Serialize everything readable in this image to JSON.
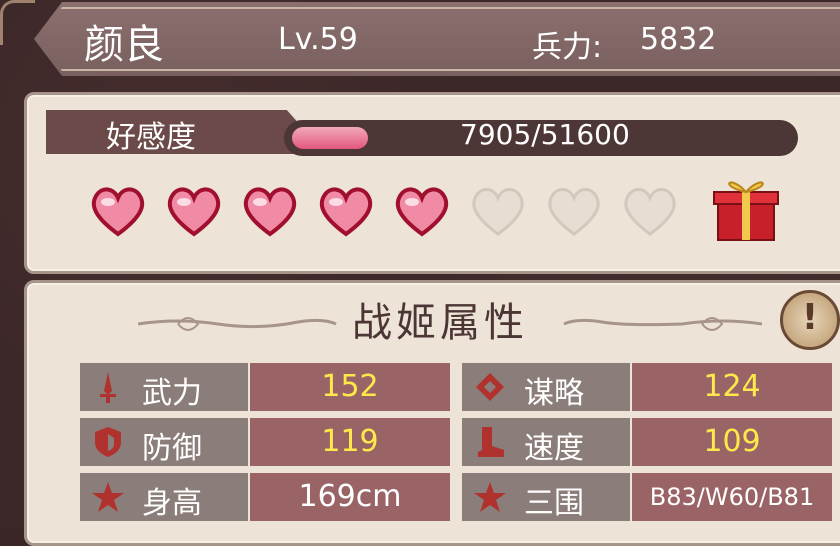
{
  "header": {
    "name": "颜良",
    "level": "Lv.59",
    "troops_label": "兵力:",
    "troops_value": "5832"
  },
  "favor": {
    "label": "好感度",
    "progress_text": "7905/51600",
    "current": 7905,
    "max": 51600,
    "hearts_filled": 5,
    "hearts_total": 8
  },
  "attributes": {
    "title": "战姬属性",
    "rows": [
      {
        "icon": "sword-icon",
        "label": "武力",
        "value": "152"
      },
      {
        "icon": "strategy-icon",
        "label": "谋略",
        "value": "124"
      },
      {
        "icon": "shield-icon",
        "label": "防御",
        "value": "119"
      },
      {
        "icon": "boot-icon",
        "label": "速度",
        "value": "109"
      },
      {
        "icon": "star-icon",
        "label": "身高",
        "value": "169cm"
      },
      {
        "icon": "star-icon",
        "label": "三围",
        "value": "B83/W60/B81"
      }
    ]
  },
  "colors": {
    "accent_pink": "#e2577d",
    "value_yellow": "#ffe94a",
    "panel_bg": "#ede3d6"
  }
}
